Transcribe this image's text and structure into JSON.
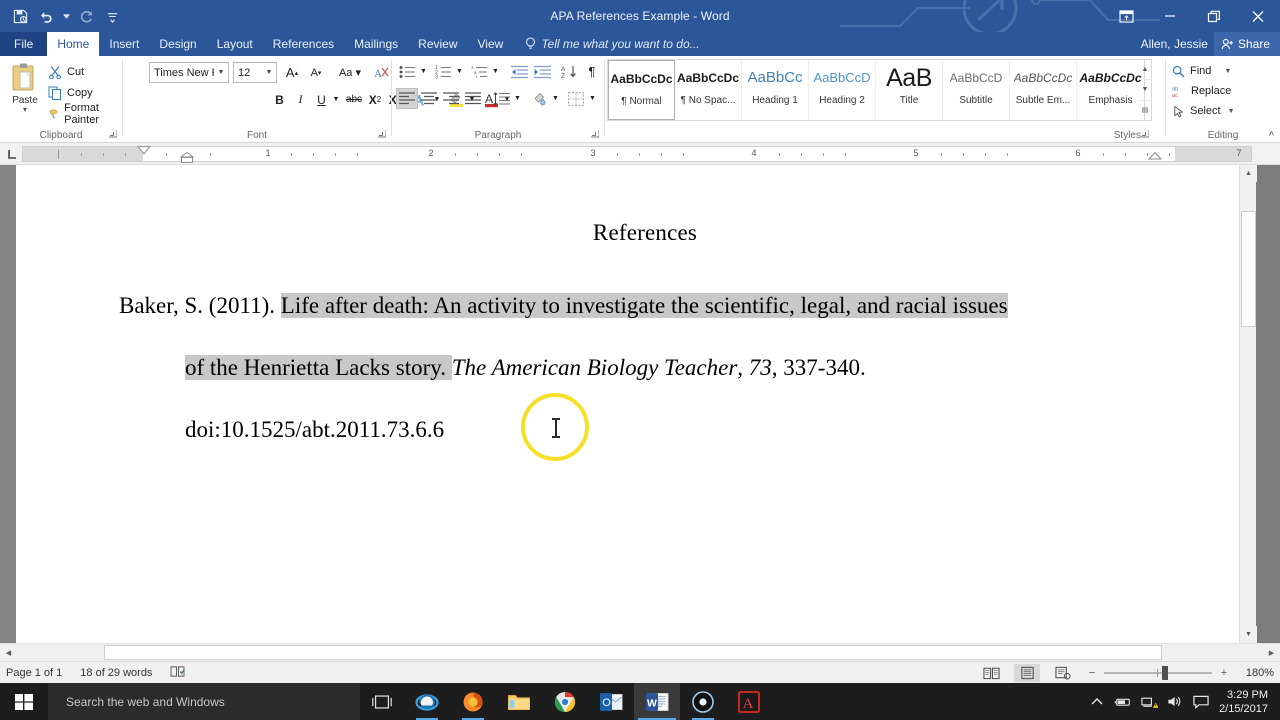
{
  "window": {
    "title": "APA References Example - Word",
    "user": "Allen, Jessie",
    "share_label": "Share",
    "quick_access": [
      "save-icon",
      "undo-icon",
      "redo-icon",
      "customize-qat-icon"
    ],
    "controls": [
      "ribbon-display-options-icon",
      "minimize-icon",
      "restore-icon",
      "close-icon"
    ]
  },
  "ribbon": {
    "tabs": [
      {
        "label": "File",
        "active": false
      },
      {
        "label": "Home",
        "active": true
      },
      {
        "label": "Insert",
        "active": false
      },
      {
        "label": "Design",
        "active": false
      },
      {
        "label": "Layout",
        "active": false
      },
      {
        "label": "References",
        "active": false
      },
      {
        "label": "Mailings",
        "active": false
      },
      {
        "label": "Review",
        "active": false
      },
      {
        "label": "View",
        "active": false
      }
    ],
    "tell_me": "Tell me what you want to do...",
    "clipboard": {
      "group_label": "Clipboard",
      "paste_label": "Paste",
      "items": [
        {
          "label": "Cut",
          "icon": "scissors-icon"
        },
        {
          "label": "Copy",
          "icon": "copy-icon"
        },
        {
          "label": "Format Painter",
          "icon": "format-painter-icon"
        }
      ]
    },
    "font": {
      "group_label": "Font",
      "font_name": "Times New Ro",
      "font_size": "12",
      "buttons": [
        "grow-font-icon",
        "shrink-font-icon",
        "change-case-icon",
        "clear-formatting-icon",
        "bold-icon",
        "italic-icon",
        "underline-icon",
        "strikethrough-icon",
        "subscript-icon",
        "superscript-icon",
        "text-effects-icon",
        "text-highlight-color-icon",
        "font-color-icon"
      ]
    },
    "paragraph": {
      "group_label": "Paragraph",
      "buttons": [
        "bullets-icon",
        "numbering-icon",
        "multilevel-list-icon",
        "decrease-indent-icon",
        "increase-indent-icon",
        "sort-icon",
        "show-formatting-marks-icon",
        "align-left-icon",
        "align-center-icon",
        "align-right-icon",
        "justify-icon",
        "line-spacing-icon",
        "shading-icon",
        "borders-icon"
      ],
      "active_alignment": "align-left-icon"
    },
    "styles": {
      "group_label": "Styles",
      "items": [
        {
          "preview": "AaBbCcDc",
          "name": "¶ Normal",
          "selected": true
        },
        {
          "preview": "AaBbCcDc",
          "name": "¶ No Spac...",
          "selected": false
        },
        {
          "preview": "AaBbCc",
          "name": "Heading 1",
          "selected": false
        },
        {
          "preview": "AaBbCcD",
          "name": "Heading 2",
          "selected": false
        },
        {
          "preview": "AaB",
          "name": "Title",
          "selected": false
        },
        {
          "preview": "AaBbCcD",
          "name": "Subtitle",
          "selected": false
        },
        {
          "preview": "AaBbCcDc",
          "name": "Subtle Em...",
          "selected": false
        },
        {
          "preview": "AaBbCcDc",
          "name": "Emphasis",
          "selected": false
        }
      ]
    },
    "editing": {
      "group_label": "Editing",
      "items": [
        {
          "label": "Find",
          "icon": "search-icon"
        },
        {
          "label": "Replace",
          "icon": "replace-icon"
        },
        {
          "label": "Select",
          "icon": "select-pointer-icon"
        }
      ]
    }
  },
  "ruler": {
    "numbers": [
      "1",
      "2",
      "3",
      "4",
      "5",
      "6",
      "7"
    ],
    "left_indent_marker": "hanging-indent-marker",
    "first_line_marker": "first-line-indent-marker",
    "right_indent_marker": "right-indent-marker"
  },
  "document": {
    "title": "References",
    "reference": {
      "line1_plain": "Baker, S. (2011). ",
      "line1_selected": "Life after death: An activity to investigate the scientific, legal, and racial issues",
      "line2_selected": "of the Henrietta Lacks story. ",
      "line2_journal": "The American Biology Teacher",
      "line2_volume_sep": ", ",
      "line2_volume": "73",
      "line2_pages": ", 337-340.",
      "line3": "doi:10.1525/abt.2011.73.6.6"
    },
    "selection_color": "#c8c8c8",
    "cursor_highlight_color": "#f5e027"
  },
  "status_bar": {
    "page": "Page 1 of 1",
    "words": "18 of 29 words",
    "proofing_icon": "proofing-errors-icon",
    "views": [
      "read-mode-icon",
      "print-layout-icon",
      "web-layout-icon"
    ],
    "active_view": "print-layout-icon",
    "zoom_out": "−",
    "zoom_in": "+",
    "zoom_level": "180%"
  },
  "taskbar": {
    "start_icon": "windows-start-icon",
    "search_placeholder": "Search the web and Windows",
    "task_view_icon": "task-view-icon",
    "apps": [
      {
        "name": "internet-explorer-icon",
        "state": "open"
      },
      {
        "name": "firefox-icon",
        "state": "open"
      },
      {
        "name": "file-explorer-icon",
        "state": "idle"
      },
      {
        "name": "chrome-icon",
        "state": "idle"
      },
      {
        "name": "outlook-icon",
        "state": "idle"
      },
      {
        "name": "word-icon",
        "state": "active"
      },
      {
        "name": "media-player-icon",
        "state": "open"
      },
      {
        "name": "adobe-reader-icon",
        "state": "idle"
      }
    ],
    "tray": [
      "show-hidden-icons-icon",
      "battery-icon",
      "network-warning-icon",
      "volume-icon",
      "action-center-icon"
    ],
    "time": "3:29 PM",
    "date": "2/15/2017"
  }
}
